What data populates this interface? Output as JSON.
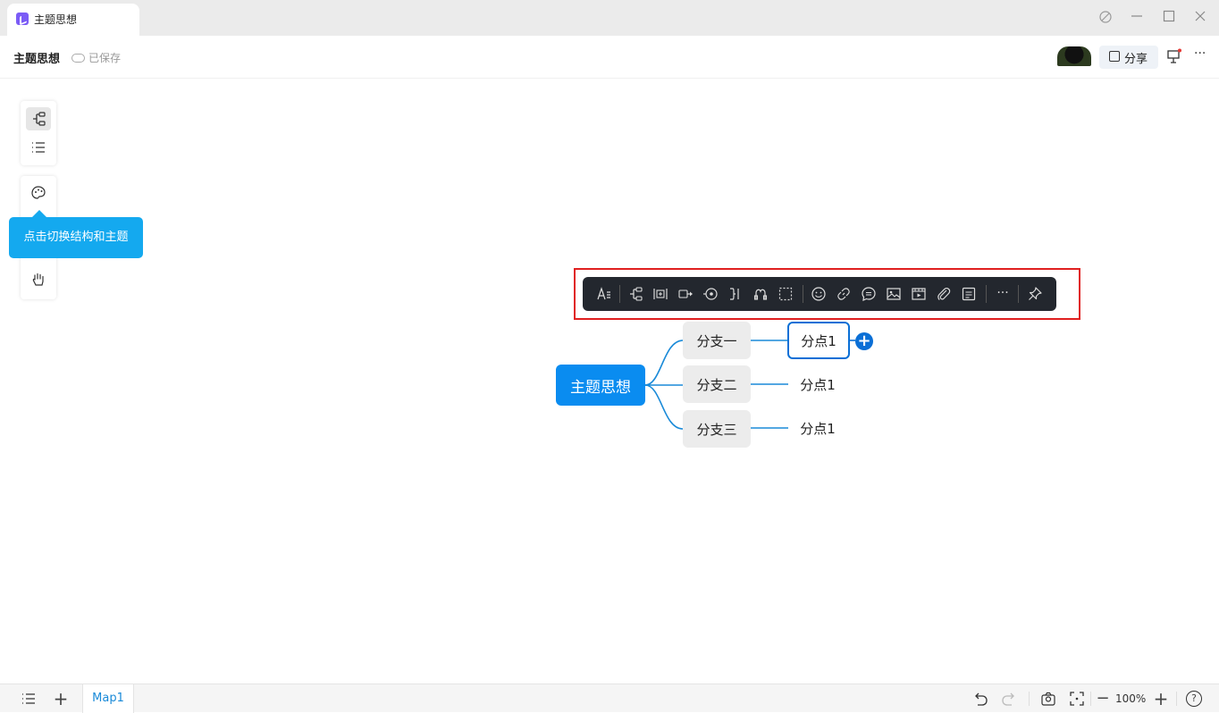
{
  "window": {
    "tab_title": "主题思想",
    "controls": [
      "sync-icon",
      "minimize-icon",
      "maximize-icon",
      "close-icon"
    ]
  },
  "header": {
    "doc_title": "主题思想",
    "save_status": "已保存",
    "share_label": "分享",
    "more_label": "···"
  },
  "left_toolbar": {
    "tooltip": "点击切换结构和主题"
  },
  "float_toolbar": {
    "more_label": "···"
  },
  "mindmap": {
    "root": "主题思想",
    "branches": [
      {
        "label": "分支一",
        "child": "分点1"
      },
      {
        "label": "分支二",
        "child": "分点1"
      },
      {
        "label": "分支三",
        "child": "分点1"
      }
    ],
    "add_label": "+",
    "colors": {
      "root": "#0a8cf0",
      "line": "#1a8ad8",
      "selected": "#0a6fd6"
    }
  },
  "bottom_bar": {
    "sheet_tab": "Map1",
    "zoom": "100%",
    "zoom_out": "−",
    "zoom_in": "+",
    "add_sheet": "+",
    "help": "?"
  }
}
